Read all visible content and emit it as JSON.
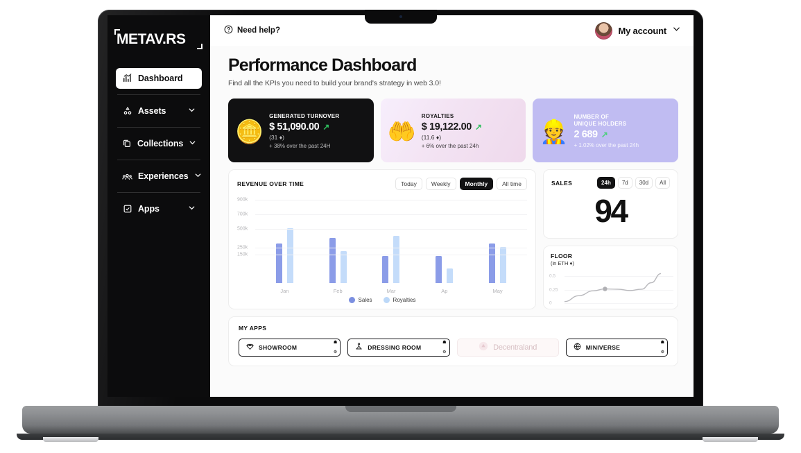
{
  "brand": {
    "logo_text": "METAV.RS"
  },
  "sidebar": {
    "items": [
      {
        "label": "Dashboard",
        "icon": "chart-bar-icon",
        "active": true,
        "chevron": ""
      },
      {
        "label": "Assets",
        "icon": "assets-icon",
        "active": false,
        "chevron": "⌄"
      },
      {
        "label": "Collections",
        "icon": "collections-icon",
        "active": false,
        "chevron": "⌄"
      },
      {
        "label": "Experiences",
        "icon": "experiences-icon",
        "active": false,
        "chevron": "⌄"
      },
      {
        "label": "Apps",
        "icon": "apps-icon",
        "active": false,
        "chevron": "⌄"
      }
    ]
  },
  "topbar": {
    "help_label": "Need help?",
    "account_label": "My account",
    "account_chevron": "⌄"
  },
  "header": {
    "title": "Performance Dashboard",
    "subtitle": "Find all the KPIs you need to build your brand's strategy in web 3.0!"
  },
  "kpis": [
    {
      "label": "GENERATED TURNOVER",
      "value": "$ 51,090.00",
      "trend": "↗",
      "sub": "(31 ♦)",
      "note": "+ 38% over the past 24H",
      "emoji": "🪙",
      "theme": "dark"
    },
    {
      "label": "ROYALTIES",
      "value": "$ 19,122.00",
      "trend": "↗",
      "sub": "(11.6 ♦)",
      "note": "+ 6% over the past 24h",
      "emoji": "🤲",
      "theme": "pink"
    },
    {
      "label": "NUMBER OF\nUNIQUE HOLDERS",
      "label_line1": "NUMBER OF",
      "label_line2": "UNIQUE HOLDERS",
      "value": "2 689",
      "trend": "↗",
      "sub": "",
      "note": "+ 1.02% over the past 24h",
      "emoji": "👷",
      "theme": "purple"
    }
  ],
  "revenue_card": {
    "title": "REVENUE OVER TIME",
    "ranges": [
      {
        "label": "Today",
        "active": false
      },
      {
        "label": "Weekly",
        "active": false
      },
      {
        "label": "Monthly",
        "active": true
      },
      {
        "label": "All time",
        "active": false
      }
    ]
  },
  "sales_card": {
    "title": "SALES",
    "value": "94",
    "ranges": [
      {
        "label": "24h",
        "active": true
      },
      {
        "label": "7d",
        "active": false
      },
      {
        "label": "30d",
        "active": false
      },
      {
        "label": "All",
        "active": false
      }
    ]
  },
  "floor_card": {
    "title": "FLOOR",
    "unit": "(in ETH ♦)"
  },
  "apps_card": {
    "title": "MY APPS",
    "apps": [
      {
        "label": "SHOWROOM",
        "icon": "diamond-icon",
        "enabled": true,
        "corner_top": "☗",
        "corner_bottom": "⚙"
      },
      {
        "label": "DRESSING ROOM",
        "icon": "hanger-icon",
        "enabled": true,
        "corner_top": "☗",
        "corner_bottom": "⚙"
      },
      {
        "label": "Decentraland",
        "icon": "decentraland-icon",
        "enabled": false,
        "corner_top": "",
        "corner_bottom": ""
      },
      {
        "label": "MINIVERSE",
        "icon": "globe-icon",
        "enabled": true,
        "corner_top": "☗",
        "corner_bottom": "⚙"
      }
    ]
  },
  "colors": {
    "sidebar_bg": "#0c0c0d",
    "accent_dark": "#111112",
    "kpi_purple": "#c0bcf2",
    "series_sales": "#8b9ce8",
    "series_royalties": "#c4dcfa",
    "trend_green": "#2fbf5e"
  },
  "chart_data": [
    {
      "type": "bar",
      "title": "REVENUE OVER TIME",
      "categories": [
        "Jan",
        "Feb",
        "Mar",
        "Ap",
        "May"
      ],
      "series": [
        {
          "name": "Sales",
          "values": [
            540,
            620,
            370,
            370,
            545
          ],
          "color": "#8b9ce8"
        },
        {
          "name": "Royalties",
          "values": [
            750,
            440,
            650,
            195,
            490
          ],
          "color": "#c4dcfa"
        }
      ],
      "ytick_labels": [
        "900k",
        "700k",
        "500k",
        "250k",
        "150k"
      ],
      "ytick_values": [
        900,
        700,
        500,
        250,
        150
      ],
      "ylim": [
        0,
        950
      ],
      "xlabel": "",
      "ylabel": "",
      "grid": true,
      "legend": "bottom-center"
    },
    {
      "type": "line",
      "title": "FLOOR",
      "ylabel": "(in ETH ♦)",
      "ytick_labels": [
        "0.5",
        "0.25",
        "0"
      ],
      "ytick_values": [
        0.5,
        0.25,
        0
      ],
      "ylim": [
        0,
        0.62
      ],
      "grid": true,
      "points": [
        {
          "x": 0,
          "y": 0.03
        },
        {
          "x": 15,
          "y": 0.14
        },
        {
          "x": 30,
          "y": 0.23
        },
        {
          "x": 42,
          "y": 0.265
        },
        {
          "x": 55,
          "y": 0.26
        },
        {
          "x": 68,
          "y": 0.235
        },
        {
          "x": 80,
          "y": 0.26
        },
        {
          "x": 90,
          "y": 0.38
        },
        {
          "x": 100,
          "y": 0.55
        }
      ],
      "marker": {
        "x": 42,
        "y": 0.265
      }
    }
  ]
}
